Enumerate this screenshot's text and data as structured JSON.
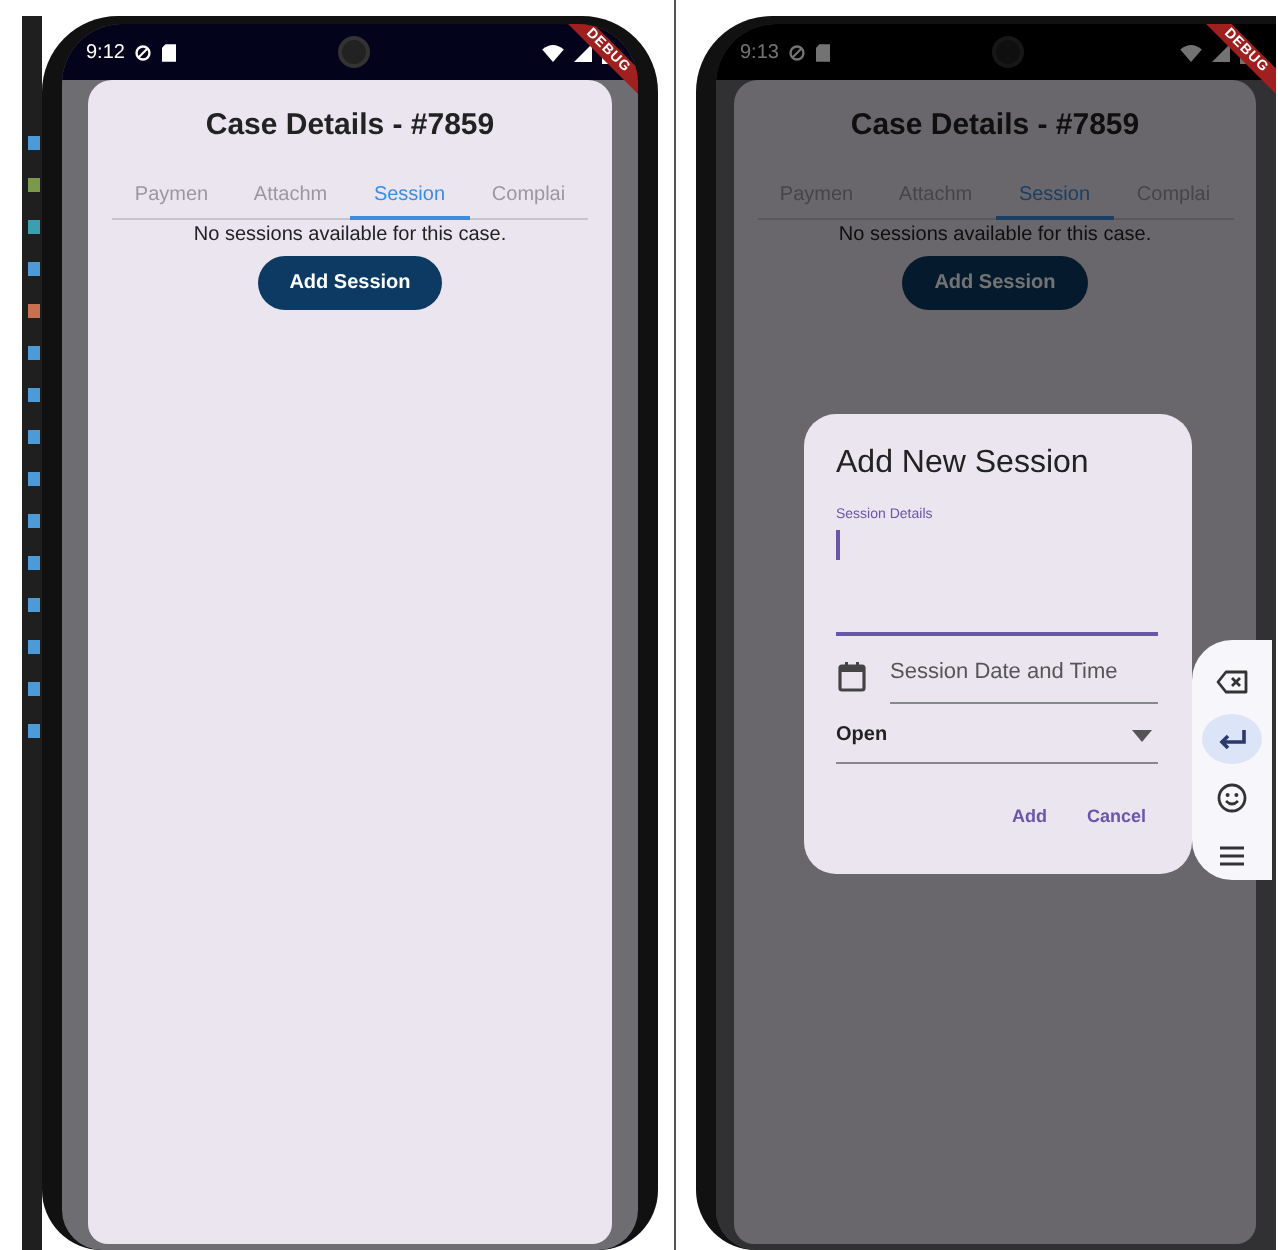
{
  "screens": [
    {
      "status_bar": {
        "time": "9:12"
      },
      "debug_banner": "DEBUG",
      "dimmed": false,
      "card": {
        "title": "Case Details - #7859",
        "tabs": [
          {
            "label": "Paymen",
            "selected": false
          },
          {
            "label": "Attachm",
            "selected": false
          },
          {
            "label": "Session",
            "selected": true
          },
          {
            "label": "Complai",
            "selected": false
          }
        ],
        "empty_message": "No sessions available for this case.",
        "add_button": "Add Session"
      }
    },
    {
      "status_bar": {
        "time": "9:13"
      },
      "debug_banner": "DEBUG",
      "dimmed": true,
      "card": {
        "title": "Case Details - #7859",
        "tabs": [
          {
            "label": "Paymen",
            "selected": false
          },
          {
            "label": "Attachm",
            "selected": false
          },
          {
            "label": "Session",
            "selected": true
          },
          {
            "label": "Complai",
            "selected": false
          }
        ],
        "empty_message": "No sessions available for this case.",
        "add_button": "Add Session"
      },
      "dialog": {
        "title": "Add New Session",
        "details_field": {
          "label": "Session Details",
          "focused": true
        },
        "date_field": {
          "placeholder": "Session Date and Time"
        },
        "status_dropdown": {
          "value": "Open"
        },
        "actions": [
          "Add",
          "Cancel"
        ]
      },
      "keyboard_toolbar": [
        {
          "kind": "backspace",
          "selected": false
        },
        {
          "kind": "enter",
          "selected": true
        },
        {
          "kind": "emoji",
          "selected": false
        },
        {
          "kind": "menu",
          "selected": false
        }
      ]
    }
  ]
}
